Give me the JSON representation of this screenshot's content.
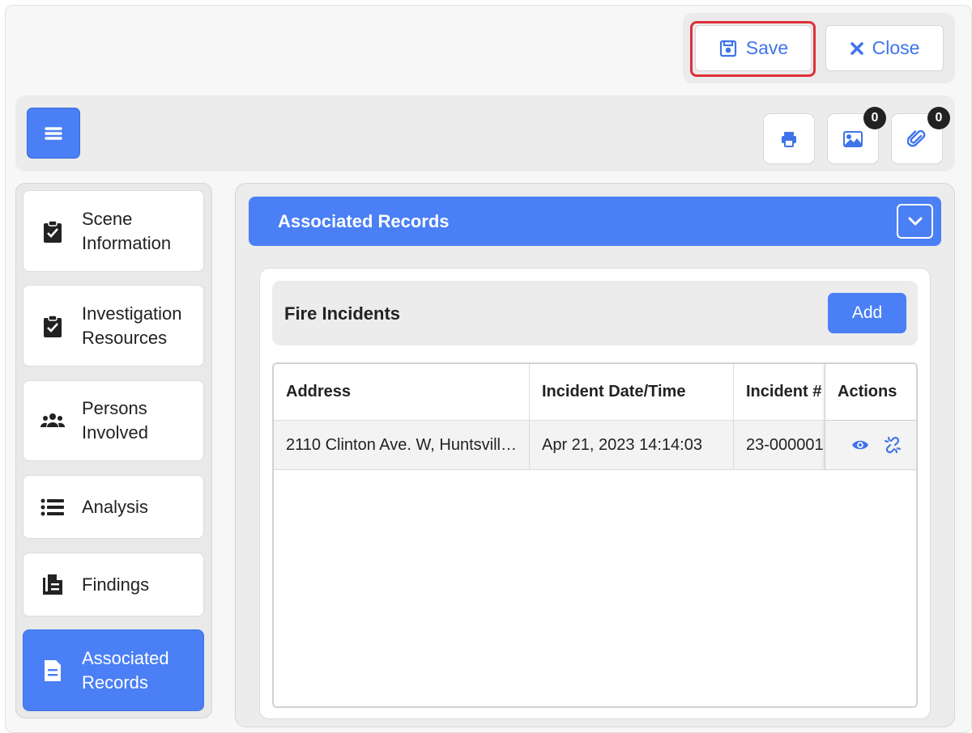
{
  "header": {
    "save_label": "Save",
    "close_label": "Close"
  },
  "toolbar": {
    "images_count": "0",
    "attachments_count": "0"
  },
  "sidebar": {
    "items": [
      {
        "label_line1": "Scene",
        "label_line2": "Information",
        "icon": "clipboard-check-icon"
      },
      {
        "label_line1": "Investigation",
        "label_line2": "Resources",
        "icon": "clipboard-check-icon"
      },
      {
        "label_line1": "Persons",
        "label_line2": "Involved",
        "icon": "users-icon"
      },
      {
        "label_line1": "Analysis",
        "label_line2": "",
        "icon": "list-icon"
      },
      {
        "label_line1": "Findings",
        "label_line2": "",
        "icon": "document-icon"
      },
      {
        "label_line1": "Associated",
        "label_line2": "Records",
        "icon": "file-text-icon",
        "active": true
      }
    ]
  },
  "main": {
    "section_title": "Associated Records",
    "card_title": "Fire Incidents",
    "add_label": "Add",
    "columns": [
      "Address",
      "Incident Date/Time",
      "Incident #",
      "Actions"
    ],
    "rows": [
      {
        "address": "2110 Clinton Ave. W, Huntsvill…",
        "datetime": "Apr 21, 2023 14:14:03",
        "incident_no": "23-000001"
      }
    ]
  },
  "colors": {
    "accent": "#4a7ff5",
    "highlight": "#e0303a"
  }
}
